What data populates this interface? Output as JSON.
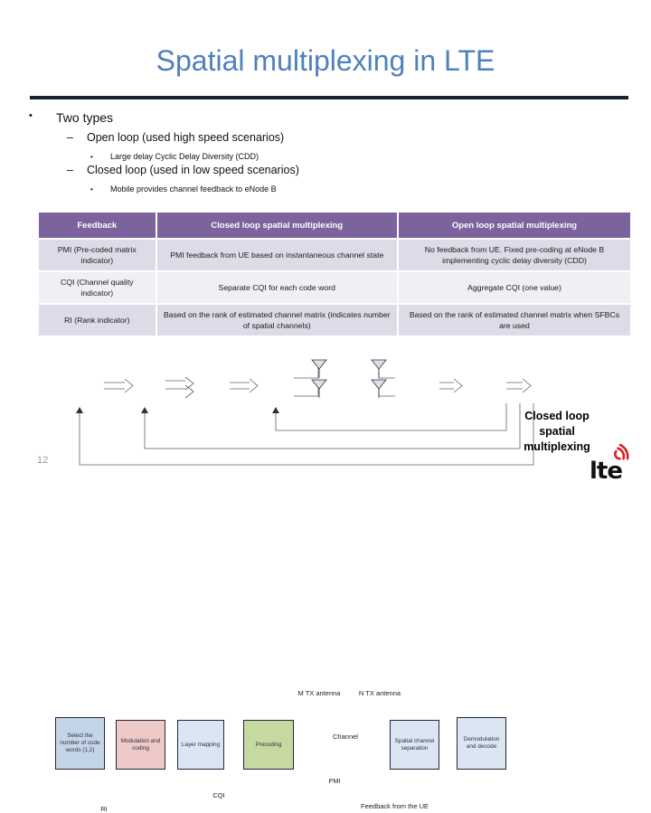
{
  "slide": {
    "title": "Spatial multiplexing in LTE",
    "page_number": "12"
  },
  "bullets": {
    "level1": "Two types",
    "level1_marker": "•",
    "level2_marker": "–",
    "level3_marker": "•",
    "open_loop": "Open loop (used high speed scenarios)",
    "open_loop_sub": "Large delay Cyclic Delay Diversity (CDD)",
    "closed_loop": "Closed loop (used in low speed scenarios)",
    "closed_loop_sub": "Mobile provides channel feedback to eNode B"
  },
  "table": {
    "headers": [
      "Feedback",
      "Closed loop spatial multiplexing",
      "Open loop spatial multiplexing"
    ],
    "rows": [
      {
        "feedback": "PMI (Pre-coded matrix indicator)",
        "closed_loop": "PMI feedback from UE based on instantaneous channel state",
        "open_loop": "No feedback from UE.  Fixed pre-coding at eNode B implementing cyclic delay diversity (CDD)"
      },
      {
        "feedback": "CQI (Channel quality indicator)",
        "closed_loop": "Separate CQI for each code word",
        "open_loop": "Aggregate CQI (one value)"
      },
      {
        "feedback": "RI (Rank indicator)",
        "closed_loop": "Based on the rank of estimated channel matrix (indicates number of spatial channels)",
        "open_loop": "Based on the rank of estimated channel matrix when SFBCs are used"
      }
    ],
    "header_color": "#7c639e",
    "row_color_a": "#dcdce8",
    "row_color_b": "#efeff4"
  },
  "diagram": {
    "blocks": [
      {
        "id": "select-code-words",
        "text": "Select the number of code words (1,2)",
        "color": "#c5d5e8"
      },
      {
        "id": "modulation-coding",
        "text": "Modulation and coding",
        "color": "#efc8c8"
      },
      {
        "id": "layer-mapping",
        "text": "Layer mapping",
        "color": "#dce6f2"
      },
      {
        "id": "precoding",
        "text": "Precoding",
        "color": "#c6d9a0"
      },
      {
        "id": "spatial-channel-separation",
        "text": "Spatial channel separation",
        "color": "#dce6f2"
      },
      {
        "id": "demodulation-decode",
        "text": "Demodulation and decode",
        "color": "#dce6f2"
      }
    ],
    "labels": {
      "m_tx_antenna": "M TX antenna",
      "n_tx_antenna": "N TX antenna",
      "channel": "Channel",
      "pmi": "PMI",
      "cqi": "CQI",
      "ri": "RI",
      "feedback_from_ue": "Feedback from the UE"
    },
    "caption": "Closed loop spatial multiplexing",
    "logo_text": "lte",
    "logo_color": "#d81f26"
  },
  "theme": {
    "title_color": "#4f81bd",
    "rule_color": "#1a2430"
  }
}
